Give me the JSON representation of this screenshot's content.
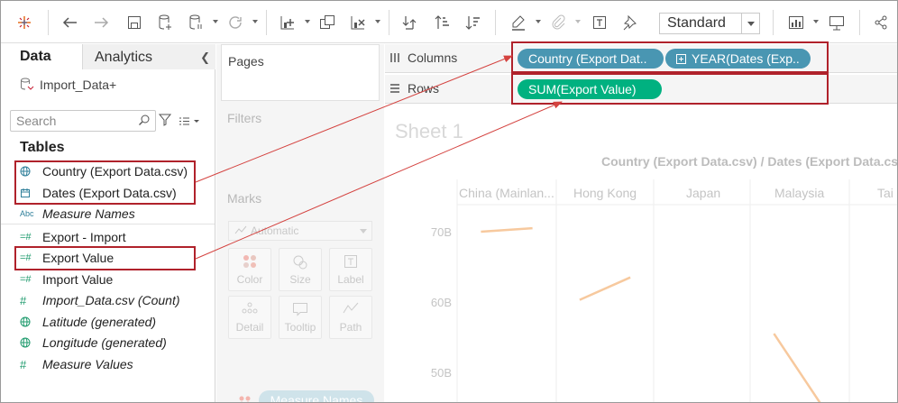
{
  "toolbar": {
    "view_select": "Standard",
    "icons": [
      "tableau-logo-icon",
      "undo-icon",
      "redo-icon",
      "save-icon",
      "new-datasource-icon",
      "pause-updates-icon",
      "refresh-icon",
      "new-sheet-icon",
      "duplicate-sheet-icon",
      "clear-sheet-icon",
      "swap-icon",
      "sort-ascending-icon",
      "sort-descending-icon",
      "highlight-icon",
      "group-icon",
      "labels-icon",
      "pin-icon",
      "show-me-icon",
      "presentation-icon",
      "share-icon"
    ]
  },
  "data_pane": {
    "tab_data": "Data",
    "tab_analytics": "Analytics",
    "datasource": "Import_Data+",
    "search_placeholder": "Search",
    "tables_heading": "Tables",
    "dimensions": [
      {
        "name": "Country (Export Data.csv)",
        "icon": "globe-icon"
      },
      {
        "name": "Dates (Export Data.csv)",
        "icon": "calendar-icon"
      },
      {
        "name": "Measure Names",
        "icon": "abc-icon"
      }
    ],
    "measures": [
      {
        "name": "Export - Import",
        "icon": "calc-measure-icon"
      },
      {
        "name": "Export Value",
        "icon": "calc-measure-icon"
      },
      {
        "name": "Import Value",
        "icon": "calc-measure-icon"
      },
      {
        "name": "Import_Data.csv (Count)",
        "icon": "measure-icon"
      },
      {
        "name": "Latitude (generated)",
        "icon": "globe-icon"
      },
      {
        "name": "Longitude (generated)",
        "icon": "globe-icon"
      },
      {
        "name": "Measure Values",
        "icon": "measure-icon"
      }
    ]
  },
  "cards": {
    "pages": "Pages",
    "filters": "Filters",
    "marks": "Marks",
    "mark_type": "Automatic",
    "buttons": [
      "Color",
      "Size",
      "Label",
      "Detail",
      "Tooltip",
      "Path"
    ],
    "measure_names_pill": "Measure Names"
  },
  "shelves": {
    "columns_label": "Columns",
    "rows_label": "Rows",
    "column_pills": [
      "Country (Export Dat..",
      "YEAR(Dates (Exp.."
    ],
    "row_pills": [
      "SUM(Export Value)"
    ]
  },
  "sheet": {
    "title": "Sheet 1",
    "header_title": "Country (Export Data.csv)  /  Dates (Export Data.csv)",
    "column_headers": [
      "China (Mainlan...",
      "Hong Kong",
      "Japan",
      "Malaysia",
      "Tai"
    ],
    "y_ticks": [
      "70B",
      "60B",
      "50B"
    ]
  },
  "colors": {
    "dimension_pill": "#4996b2",
    "measure_pill": "#00b180",
    "callout": "#b0222b",
    "line_mark": "#f7c99e"
  },
  "chart_data": {
    "type": "line",
    "ylabel": "",
    "yticks": [
      "70B",
      "60B",
      "50B"
    ],
    "series": [
      {
        "category": "China (Mainlan...",
        "y_start": 70,
        "y_end": 70.5
      },
      {
        "category": "Hong Kong",
        "y_start": 60.3,
        "y_end": 63.5
      },
      {
        "category": "Malaysia",
        "y_start": 55.5,
        "y_end": 44.5
      }
    ]
  }
}
